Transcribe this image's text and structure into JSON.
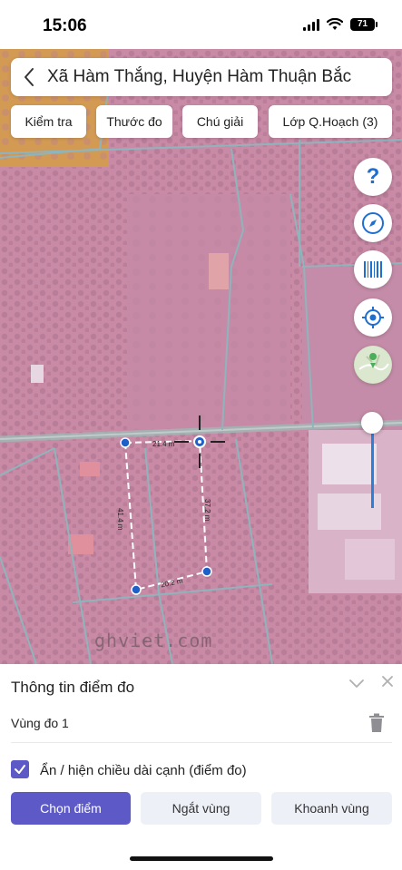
{
  "status_bar": {
    "time": "15:06",
    "battery": "71"
  },
  "header": {
    "title": "Xã Hàm Thắng, Huyện Hàm Thuận Bắc"
  },
  "toolbar": {
    "check_label": "Kiểm tra",
    "measure_label": "Thước đo",
    "legend_label": "Chú giải",
    "layer_label": "Lớp Q.Hoạch (3)"
  },
  "map": {
    "side_buttons": [
      "help-icon",
      "compass-icon",
      "barcode-icon",
      "locate-icon",
      "basemap-icon"
    ],
    "measurements": {
      "top": "21.4 m",
      "left": "41.4 m",
      "right": "37.2 m",
      "bottom": "20.2 m"
    },
    "zoom_level": 0.7,
    "watermark": "ghviet.com",
    "overlay_color": "#c98aa6",
    "line_color": "#ffffff",
    "vertex_color": "#1f5fc8"
  },
  "panel": {
    "title": "Thông tin điểm đo",
    "region_label": "Vùng đo 1",
    "toggle_label": "Ẩn / hiện chiều dài cạnh (điểm đo)",
    "toggle_checked": true,
    "buttons": {
      "select": "Chọn điểm",
      "break": "Ngắt vùng",
      "enclose": "Khoanh vùng"
    },
    "accent_color": "#5d5ac8"
  }
}
